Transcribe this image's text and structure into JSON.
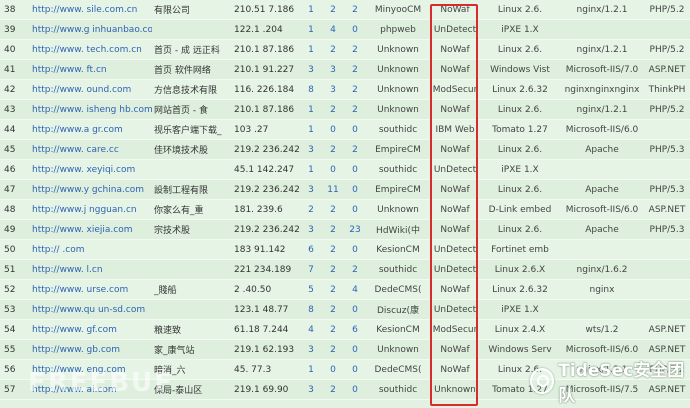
{
  "rows": [
    {
      "id": "38",
      "url": "http://www.   sile.com.cn",
      "title": "        有限公司",
      "ip": "210.51  7.186",
      "c1": "1",
      "c2": "2",
      "c3": "2",
      "cms": "MinyooCM",
      "waf": "NoWaf",
      "os": "Linux 2.6.",
      "server": "nginx/1.2.1",
      "lang": "PHP/5.2"
    },
    {
      "id": "39",
      "url": "http://www.g   inhuanbao.com",
      "title": "",
      "ip": "122.1    .204",
      "c1": "1",
      "c2": "4",
      "c3": "0",
      "cms": "phpweb",
      "waf": "UnDetect",
      "os": "iPXE 1.X",
      "server": "",
      "lang": ""
    },
    {
      "id": "40",
      "url": "http://www.   tech.com.cn",
      "title": "首页 - 成 远正科",
      "ip": "210.1   87.186",
      "c1": "1",
      "c2": "2",
      "c3": "2",
      "cms": "Unknown",
      "waf": "NoWaf",
      "os": "Linux 2.6.",
      "server": "nginx/1.2.1",
      "lang": "PHP/5.2"
    },
    {
      "id": "41",
      "url": "http://www.     ft.cn",
      "title": "首页   软件网络",
      "ip": "210.1   91.227",
      "c1": "3",
      "c2": "3",
      "c3": "2",
      "cms": "Unknown",
      "waf": "NoWaf",
      "os": "Windows Vist",
      "server": "Microsoft-IIS/7.0",
      "lang": "ASP.NET"
    },
    {
      "id": "42",
      "url": "http://www.      ound.com",
      "title": "   方信息技术有限",
      "ip": "116.    226.184",
      "c1": "8",
      "c2": "3",
      "c3": "2",
      "cms": "Unknown",
      "waf": "ModSecur",
      "os": "Linux 2.6.32",
      "server": "nginxnginxnginx",
      "lang": "ThinkPH"
    },
    {
      "id": "43",
      "url": "http://www.   isheng hb.com",
      "title": "网站首页 -    食",
      "ip": "210.1   87.186",
      "c1": "1",
      "c2": "2",
      "c3": "2",
      "cms": "Unknown",
      "waf": "NoWaf",
      "os": "Linux 2.6.",
      "server": "nginx/1.2.1",
      "lang": "PHP/5.2"
    },
    {
      "id": "44",
      "url": "http://www.a   gr.com",
      "title": "   视乐客户端下载_",
      "ip": "103    .27",
      "c1": "1",
      "c2": "0",
      "c3": "0",
      "cms": "southidc",
      "waf": "IBM Web",
      "os": "Tomato 1.27",
      "server": "Microsoft-IIS/6.0",
      "lang": ""
    },
    {
      "id": "45",
      "url": "http://www.   care.cc",
      "title": "   佳环境技术股",
      "ip": "219.2   236.242",
      "c1": "3",
      "c2": "2",
      "c3": "2",
      "cms": "EmpireCM",
      "waf": "NoWaf",
      "os": "Linux 2.6.",
      "server": "Apache",
      "lang": "PHP/5.3"
    },
    {
      "id": "46",
      "url": "http://www.   xeyiqi.com",
      "title": "",
      "ip": "45.1   142.247",
      "c1": "1",
      "c2": "0",
      "c3": "0",
      "cms": "southidc",
      "waf": "UnDetect",
      "os": "iPXE 1.X",
      "server": "",
      "lang": ""
    },
    {
      "id": "47",
      "url": "http://www.y   gchina.com",
      "title": "   設制工程有限",
      "ip": "219.2   236.242",
      "c1": "3",
      "c2": "11",
      "c3": "0",
      "cms": "EmpireCM",
      "waf": "NoWaf",
      "os": "Linux 2.6.",
      "server": "Apache",
      "lang": "PHP/5.3"
    },
    {
      "id": "48",
      "url": "http://www.j   ngguan.cn",
      "title": "   你家么有_重",
      "ip": "181.    239.6",
      "c1": "2",
      "c2": "2",
      "c3": "0",
      "cms": "Unknown",
      "waf": "NoWaf",
      "os": "D-Link embed",
      "server": "Microsoft-IIS/6.0",
      "lang": "ASP.NET"
    },
    {
      "id": "49",
      "url": "http://www.   xiejia.com",
      "title": "   宗技术股",
      "ip": "219.2   236.242",
      "c1": "3",
      "c2": "2",
      "c3": "23",
      "cms": "HdWiki(中",
      "waf": "NoWaf",
      "os": "Linux 2.6.",
      "server": "Apache",
      "lang": "PHP/5.3"
    },
    {
      "id": "50",
      "url": "http://    .com",
      "title": "",
      "ip": "183    91.142",
      "c1": "6",
      "c2": "2",
      "c3": "0",
      "cms": "KesionCM",
      "waf": "UnDetect",
      "os": "Fortinet emb",
      "server": "",
      "lang": ""
    },
    {
      "id": "51",
      "url": "http://www.   l.cn",
      "title": "",
      "ip": "221   234.189",
      "c1": "7",
      "c2": "2",
      "c3": "2",
      "cms": "southidc",
      "waf": "UnDetect",
      "os": "Linux 2.6.X",
      "server": "nginx/1.6.2",
      "lang": ""
    },
    {
      "id": "52",
      "url": "http://www.   urse.com",
      "title": "   _賤船",
      "ip": "2    .40.50",
      "c1": "5",
      "c2": "2",
      "c3": "4",
      "cms": "DedeCMS(",
      "waf": "NoWaf",
      "os": "Linux 2.6.32",
      "server": "nginx",
      "lang": ""
    },
    {
      "id": "53",
      "url": "http://www.qu   un-sd.com",
      "title": "",
      "ip": "123.1   48.77",
      "c1": "8",
      "c2": "2",
      "c3": "0",
      "cms": "Discuz(康",
      "waf": "UnDetect",
      "os": "iPXE 1.X",
      "server": "",
      "lang": ""
    },
    {
      "id": "54",
      "url": "http://www.   gf.com",
      "title": "   粮速致",
      "ip": "61.18   7.244",
      "c1": "4",
      "c2": "2",
      "c3": "6",
      "cms": "KesionCM",
      "waf": "ModSecur",
      "os": "Linux 2.4.X",
      "server": "wts/1.2",
      "lang": "ASP.NET"
    },
    {
      "id": "55",
      "url": "http://www.   gb.com",
      "title": "   家_康气站",
      "ip": "219.1   62.193",
      "c1": "3",
      "c2": "2",
      "c3": "0",
      "cms": "Unknown",
      "waf": "NoWaf",
      "os": "Windows Serv",
      "server": "Microsoft-IIS/6.0",
      "lang": "ASP.NET"
    },
    {
      "id": "56",
      "url": "http://www.   eng.com",
      "title": "   暗消_六",
      "ip": "45.    77.3",
      "c1": "1",
      "c2": "0",
      "c3": "0",
      "cms": "DedeCMS(",
      "waf": "NoWaf",
      "os": "Linux 2.6.",
      "server": "nginx/1.2.1",
      "lang": "PHP/5.2"
    },
    {
      "id": "57",
      "url": "http://www.   ai.com",
      "title": "   保局-泰山区",
      "ip": "219.1   69.90",
      "c1": "3",
      "c2": "2",
      "c3": "0",
      "cms": "southidc",
      "waf": "Unknown",
      "os": "Tomato 1.27",
      "server": "Microsoft-IIS/7.5",
      "lang": "ASP.NET"
    }
  ],
  "watermark": {
    "text": "TideSec安全团队",
    "icon": "wechat-icon"
  },
  "bg_watermark": "FREEBUF",
  "colors": {
    "link": "#2d63b5",
    "highlight_border": "#d92b2b",
    "row_bg": "#e3f1e3"
  }
}
